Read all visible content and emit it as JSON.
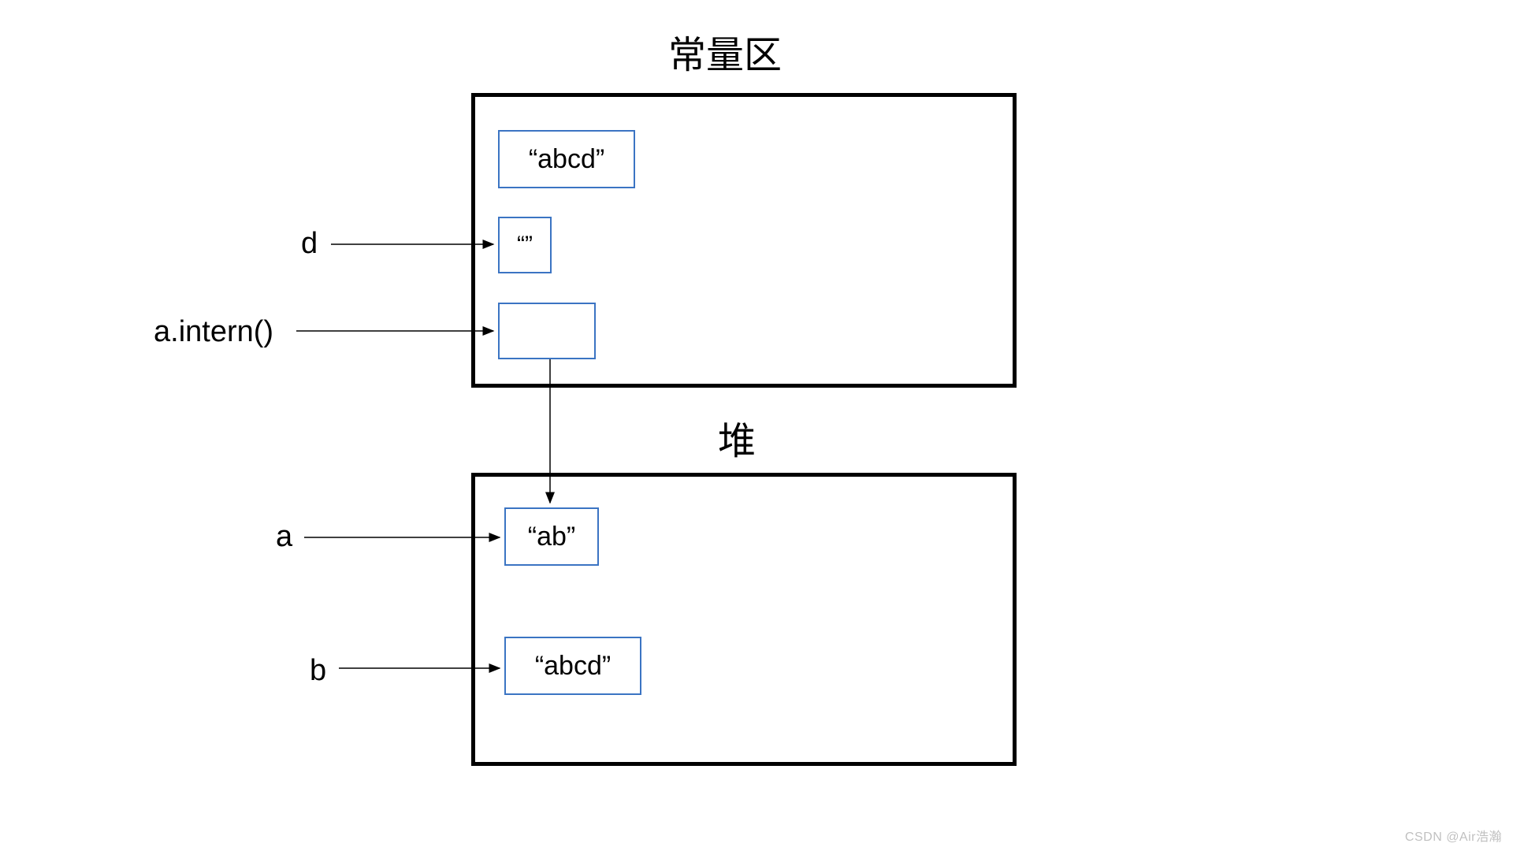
{
  "titles": {
    "constant_pool": "常量区",
    "heap": "堆"
  },
  "labels": {
    "d": "d",
    "a_intern": "a.intern()",
    "a": "a",
    "b": "b"
  },
  "cells": {
    "pool_abcd": "“abcd”",
    "pool_empty": "“”",
    "pool_ref": "",
    "heap_ab": "“ab”",
    "heap_abcd": "“abcd”"
  },
  "watermark": "CSDN @Air浩瀚"
}
